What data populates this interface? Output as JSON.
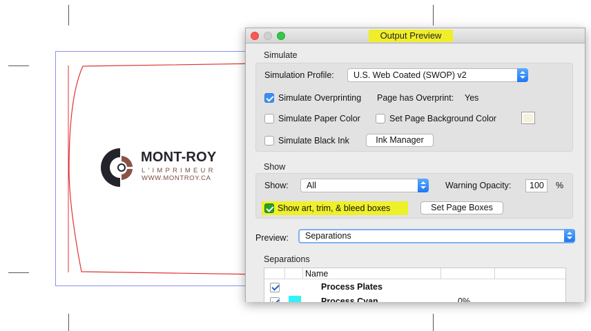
{
  "document": {
    "logo": {
      "name": "MONT-ROY",
      "tagline": "L'IMPRIMEUR",
      "website": "WWW.MONTROY.CA"
    }
  },
  "window": {
    "title": "Output Preview",
    "simulate": {
      "section_label": "Simulate",
      "profile_label": "Simulation Profile:",
      "profile_value": "U.S. Web Coated (SWOP) v2",
      "simulate_overprinting": {
        "label": "Simulate Overprinting",
        "checked": true
      },
      "page_has_overprint_label": "Page has Overprint:",
      "page_has_overprint_value": "Yes",
      "simulate_paper_color": {
        "label": "Simulate Paper Color",
        "checked": false
      },
      "set_page_bg_color": {
        "label": "Set Page Background Color",
        "checked": false
      },
      "simulate_black_ink": {
        "label": "Simulate Black Ink",
        "checked": false
      },
      "ink_manager_label": "Ink Manager"
    },
    "show": {
      "section_label": "Show",
      "show_label": "Show:",
      "show_value": "All",
      "warning_opacity_label": "Warning Opacity:",
      "warning_opacity_value": "100",
      "warning_opacity_unit": "%",
      "show_boxes": {
        "label": "Show art, trim, & bleed boxes",
        "checked": true
      },
      "set_page_boxes_label": "Set Page Boxes"
    },
    "preview": {
      "label": "Preview:",
      "value": "Separations"
    },
    "separations": {
      "section_label": "Separations",
      "columns": [
        "Name"
      ],
      "rows": [
        {
          "name": "Process Plates",
          "checked": true,
          "value": ""
        },
        {
          "name": "Process Cyan",
          "checked": true,
          "value": "0%",
          "color": "#2ef3f7"
        }
      ]
    }
  },
  "colors": {
    "highlight": "#f0ee2a",
    "accent": "#3a8df7",
    "bleed_line": "#e03030",
    "trim_line": "#8c8ff0"
  }
}
